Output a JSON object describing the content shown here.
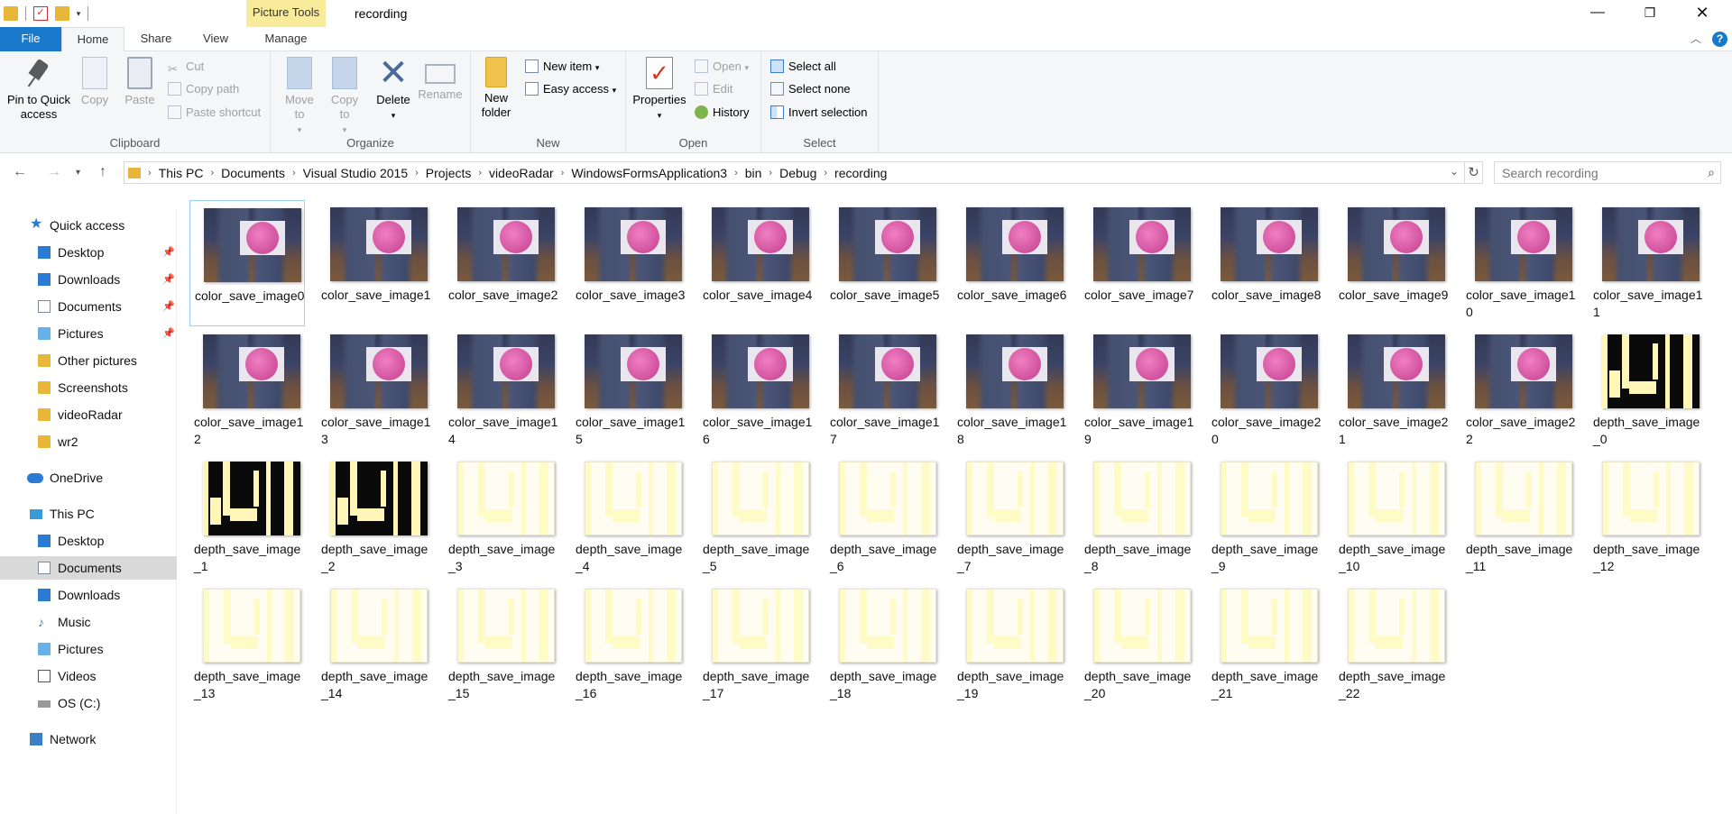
{
  "window": {
    "title": "recording",
    "context_tab": "Picture Tools"
  },
  "ribbon_tabs": {
    "file": "File",
    "home": "Home",
    "share": "Share",
    "view": "View",
    "manage": "Manage"
  },
  "ribbon": {
    "clipboard": {
      "label": "Clipboard",
      "pin": "Pin to Quick access",
      "copy": "Copy",
      "paste": "Paste",
      "cut": "Cut",
      "copy_path": "Copy path",
      "paste_shortcut": "Paste shortcut"
    },
    "organize": {
      "label": "Organize",
      "move_to": "Move to",
      "copy_to": "Copy to",
      "delete": "Delete",
      "rename": "Rename"
    },
    "new": {
      "label": "New",
      "new_folder": "New folder",
      "new_item": "New item",
      "easy_access": "Easy access"
    },
    "open": {
      "label": "Open",
      "properties": "Properties",
      "open": "Open",
      "edit": "Edit",
      "history": "History"
    },
    "select": {
      "label": "Select",
      "select_all": "Select all",
      "select_none": "Select none",
      "invert_selection": "Invert selection"
    }
  },
  "address": {
    "crumbs": [
      "This PC",
      "Documents",
      "Visual Studio 2015",
      "Projects",
      "videoRadar",
      "WindowsFormsApplication3",
      "bin",
      "Debug",
      "recording"
    ],
    "search_placeholder": "Search recording"
  },
  "navpane": {
    "quick_access": "Quick access",
    "quick_items": [
      "Desktop",
      "Downloads",
      "Documents",
      "Pictures",
      "Other pictures",
      "Screenshots",
      "videoRadar",
      "wr2"
    ],
    "onedrive": "OneDrive",
    "this_pc": "This PC",
    "pc_items": [
      "Desktop",
      "Documents",
      "Downloads",
      "Music",
      "Pictures",
      "Videos",
      "OS (C:)"
    ],
    "network": "Network"
  },
  "files": [
    "color_save_image0",
    "color_save_image1",
    "color_save_image2",
    "color_save_image3",
    "color_save_image4",
    "color_save_image5",
    "color_save_image6",
    "color_save_image7",
    "color_save_image8",
    "color_save_image9",
    "color_save_image10",
    "color_save_image11",
    "color_save_image12",
    "color_save_image13",
    "color_save_image14",
    "color_save_image15",
    "color_save_image16",
    "color_save_image17",
    "color_save_image18",
    "color_save_image19",
    "color_save_image20",
    "color_save_image21",
    "color_save_image22",
    "depth_save_image_0",
    "depth_save_image_1",
    "depth_save_image_2",
    "depth_save_image_3",
    "depth_save_image_4",
    "depth_save_image_5",
    "depth_save_image_6",
    "depth_save_image_7",
    "depth_save_image_8",
    "depth_save_image_9",
    "depth_save_image_10",
    "depth_save_image_11",
    "depth_save_image_12",
    "depth_save_image_13",
    "depth_save_image_14",
    "depth_save_image_15",
    "depth_save_image_16",
    "depth_save_image_17",
    "depth_save_image_18",
    "depth_save_image_19",
    "depth_save_image_20",
    "depth_save_image_21",
    "depth_save_image_22"
  ]
}
